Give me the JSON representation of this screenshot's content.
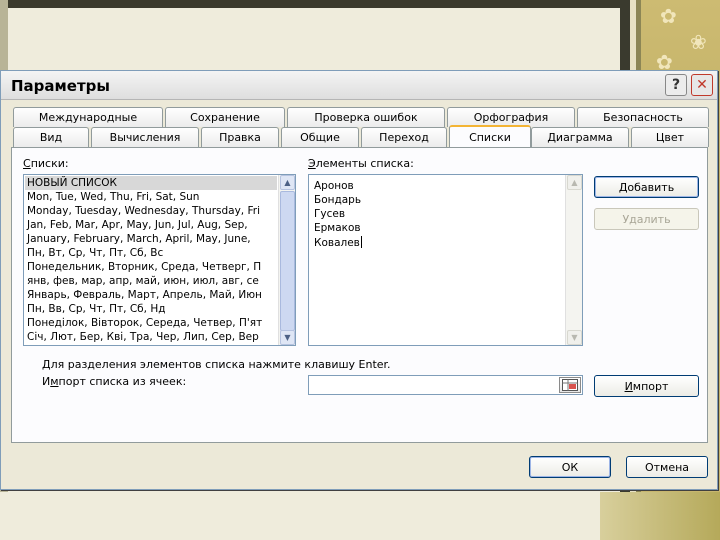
{
  "dialog": {
    "title": "Параметры",
    "help_label": "?",
    "close_label": "✕"
  },
  "tabs_row1": [
    "Международные",
    "Сохранение",
    "Проверка ошибок",
    "Орфография",
    "Безопасность"
  ],
  "tabs_row2": [
    "Вид",
    "Вычисления",
    "Правка",
    "Общие",
    "Переход",
    "Списки",
    "Диаграмма",
    "Цвет"
  ],
  "active_tab": "Списки",
  "lists": {
    "label_first": "С",
    "label_rest": "писки:",
    "items": [
      "НОВЫЙ СПИСОК",
      "Mon, Tue, Wed, Thu, Fri, Sat, Sun",
      "Monday, Tuesday, Wednesday, Thursday, Fri",
      "Jan, Feb, Mar, Apr, May, Jun, Jul, Aug, Sep,",
      "January, February, March, April, May, June,",
      "Пн, Вт, Ср, Чт, Пт, Сб, Вс",
      "Понедельник, Вторник, Среда, Четверг, П",
      "янв, фев, мар, апр, май, июн, июл, авг, се",
      "Январь, Февраль, Март, Апрель, Май, Июн",
      "Пн, Вв, Ср, Чт, Пт, Сб, Нд",
      "Понеділок, Вівторок, Середа, Четвер, П'ят",
      "Січ, Лют, Бер, Кві, Тра, Чер, Лип, Сер, Вер"
    ],
    "selected_index": 0
  },
  "elements": {
    "label_first": "Э",
    "label_rest": "лементы списка:",
    "items": [
      "Аронов",
      "Бондарь",
      "Гусев",
      "Ермаков",
      "Ковалев"
    ]
  },
  "buttons": {
    "add_first": "Д",
    "add_rest": "обавить",
    "delete": "Удалить",
    "import_first": "И",
    "import_rest": "мпорт",
    "ok": "ОК",
    "cancel": "Отмена"
  },
  "hint_text": "Для разделения элементов списка нажмите клавишу Enter.",
  "import": {
    "label_pre": "И",
    "label_mid": "м",
    "label_rest": "порт списка из ячеек:",
    "value": ""
  },
  "colors": {
    "accent_tab": "#f3b434",
    "button_border": "#003c74",
    "field_border": "#7f9db9"
  }
}
